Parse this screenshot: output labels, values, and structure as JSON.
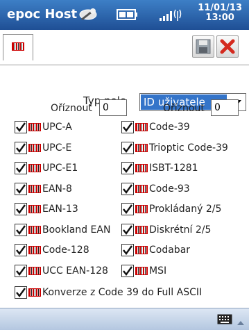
{
  "titlebar": {
    "app_title": "epoc Host",
    "clock_date": "11/01/13",
    "clock_time": "13:00",
    "icons": [
      "sync-icon",
      "battery-icon",
      "signal-icon"
    ]
  },
  "toolbar": {
    "tab_icon": "barcode-icon",
    "save_icon": "floppy-save-icon",
    "close_icon": "red-x-icon"
  },
  "form": {
    "field_type_label": "Typ pole",
    "field_type_value": "ID uživatele",
    "trim_left_label": "Oříznout",
    "trim_left_value": "0",
    "trim_right_label": "Oříznout",
    "trim_right_value": "0"
  },
  "symbologies_left": [
    {
      "label": "UPC-A",
      "checked": true
    },
    {
      "label": "UPC-E",
      "checked": true
    },
    {
      "label": "UPC-E1",
      "checked": true
    },
    {
      "label": "EAN-8",
      "checked": true
    },
    {
      "label": "EAN-13",
      "checked": true
    },
    {
      "label": "Bookland EAN",
      "checked": true
    },
    {
      "label": "Code-128",
      "checked": true
    },
    {
      "label": "UCC EAN-128",
      "checked": true
    }
  ],
  "symbologies_right": [
    {
      "label": "Code-39",
      "checked": true
    },
    {
      "label": "Trioptic Code-39",
      "checked": true
    },
    {
      "label": "ISBT-1281",
      "checked": true
    },
    {
      "label": "Code-93",
      "checked": true
    },
    {
      "label": "Prokládaný 2/5",
      "checked": true
    },
    {
      "label": "Diskrétní 2/5",
      "checked": true
    },
    {
      "label": "Codabar",
      "checked": true
    },
    {
      "label": "MSI",
      "checked": true
    }
  ],
  "full_ascii": {
    "label": "Konverze z Code 39 do Full ASCII",
    "checked": true
  },
  "bottombar": {
    "keyboard_icon": "keyboard-icon"
  },
  "colors": {
    "title_bar": "#2b64ad",
    "selection": "#3474c9",
    "barcode_red": "#cc0000"
  }
}
